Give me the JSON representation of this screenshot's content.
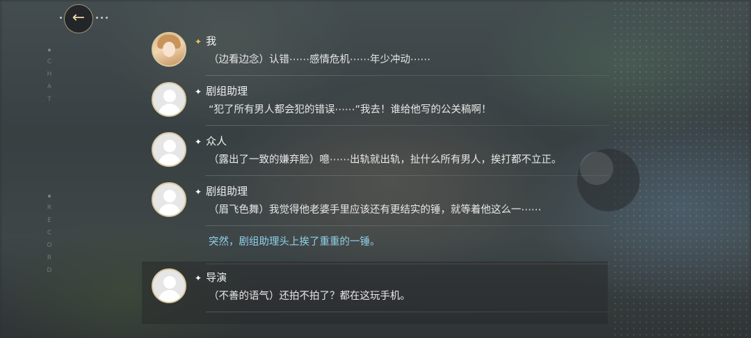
{
  "nav": {
    "back_label": "←",
    "side_top": [
      "C",
      "H",
      "A",
      "T"
    ],
    "side_bottom": [
      "R",
      "E",
      "C",
      "O",
      "R",
      "D"
    ]
  },
  "entries": [
    {
      "speaker": "我",
      "text": "（边看边念）认错⋯⋯感情危机⋯⋯年少冲动⋯⋯"
    },
    {
      "speaker": "剧组助理",
      "text": "“犯了所有男人都会犯的错误⋯⋯”我去！谁给他写的公关稿啊！"
    },
    {
      "speaker": "众人",
      "text": "（露出了一致的嫌弃脸）噫⋯⋯出轨就出轨，扯什么所有男人，挨打都不立正。"
    },
    {
      "speaker": "剧组助理",
      "text": "（眉飞色舞）我觉得他老婆手里应该还有更结实的锤，就等着他这么一⋯⋯"
    }
  ],
  "narration": {
    "text": "突然，剧组助理头上挨了重重的一锤。"
  },
  "last_entry": {
    "speaker": "导演",
    "text": "（不善的语气）还拍不拍了？都在这玩手机。"
  },
  "colors": {
    "accent_gold": "#f0c74f",
    "narration": "#8fd1ea"
  }
}
